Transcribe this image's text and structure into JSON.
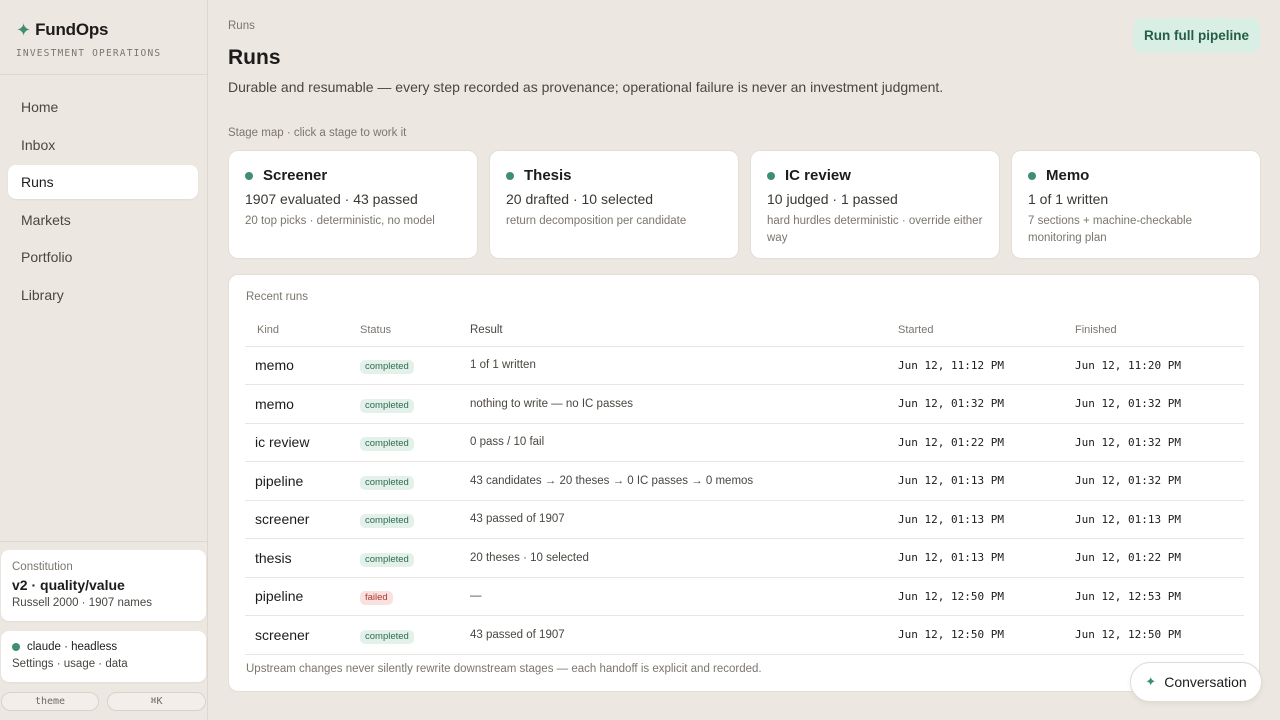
{
  "brand": {
    "name": "FundOps",
    "subtitle": "INVESTMENT OPERATIONS",
    "icon": "sparkle-icon"
  },
  "nav": {
    "items": [
      {
        "label": "Home",
        "active": false
      },
      {
        "label": "Inbox",
        "active": false
      },
      {
        "label": "Runs",
        "active": true
      },
      {
        "label": "Markets",
        "active": false
      },
      {
        "label": "Portfolio",
        "active": false
      },
      {
        "label": "Library",
        "active": false
      }
    ]
  },
  "constitution": {
    "label": "Constitution",
    "title": "v2 · quality/value",
    "sub": "Russell 2000 · 1907 names"
  },
  "agent": {
    "name": "claude · headless",
    "sub": "Settings · usage · data",
    "status_color": "#3f8f6e"
  },
  "footer_pills": {
    "theme": "theme",
    "shortcut": "⌘K"
  },
  "header": {
    "breadcrumb": "Runs",
    "title": "Runs",
    "subtitle": "Durable and resumable — every step recorded as provenance; operational failure is never an investment judgment.",
    "run_button": "Run full pipeline"
  },
  "stage_map": {
    "label": "Stage map · click a stage to work it",
    "stages": [
      {
        "name": "Screener",
        "stat": "1907 evaluated · 43 passed",
        "note": "20 top picks · deterministic, no model"
      },
      {
        "name": "Thesis",
        "stat": "20 drafted · 10 selected",
        "note": "return decomposition per candidate"
      },
      {
        "name": "IC review",
        "stat": "10 judged · 1 passed",
        "note": "hard hurdles deterministic · override either way"
      },
      {
        "name": "Memo",
        "stat": "1 of 1 written",
        "note": "7 sections + machine-checkable monitoring plan"
      }
    ]
  },
  "recent_runs": {
    "label": "Recent runs",
    "columns": {
      "kind": "Kind",
      "status": "Status",
      "result": "Result",
      "started": "Started",
      "finished": "Finished"
    },
    "rows": [
      {
        "kind": "memo",
        "status": "completed",
        "result": "1 of 1 written",
        "started": "Jun 12, 11:12 PM",
        "finished": "Jun 12, 11:20 PM"
      },
      {
        "kind": "memo",
        "status": "completed",
        "result": "nothing to write — no IC passes",
        "started": "Jun 12, 01:32 PM",
        "finished": "Jun 12, 01:32 PM"
      },
      {
        "kind": "ic review",
        "status": "completed",
        "result": "0 pass / 10 fail",
        "started": "Jun 12, 01:22 PM",
        "finished": "Jun 12, 01:32 PM"
      },
      {
        "kind": "pipeline",
        "status": "completed",
        "result": "43 candidates → 20 theses → 0 IC passes → 0 memos",
        "started": "Jun 12, 01:13 PM",
        "finished": "Jun 12, 01:32 PM"
      },
      {
        "kind": "screener",
        "status": "completed",
        "result": "43 passed of 1907",
        "started": "Jun 12, 01:13 PM",
        "finished": "Jun 12, 01:13 PM"
      },
      {
        "kind": "thesis",
        "status": "completed",
        "result": "20 theses · 10 selected",
        "started": "Jun 12, 01:13 PM",
        "finished": "Jun 12, 01:22 PM"
      },
      {
        "kind": "pipeline",
        "status": "failed",
        "result": "—",
        "started": "Jun 12, 12:50 PM",
        "finished": "Jun 12, 12:53 PM"
      },
      {
        "kind": "screener",
        "status": "completed",
        "result": "43 passed of 1907",
        "started": "Jun 12, 12:50 PM",
        "finished": "Jun 12, 12:50 PM"
      }
    ],
    "footnote": "Upstream changes never silently rewrite downstream stages — each handoff is explicit and recorded."
  },
  "conversation_button": "Conversation",
  "colors": {
    "accent": "#3f8f6e",
    "completed_badge": "#e3f1ea",
    "failed_badge": "#f8e1df",
    "background": "#ece8e1"
  }
}
